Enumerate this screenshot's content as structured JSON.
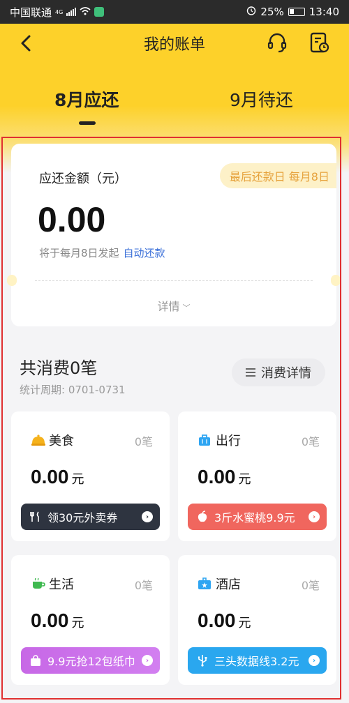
{
  "status_bar": {
    "carrier": "中国联通",
    "network": "4G",
    "battery": "25%",
    "time": "13:40"
  },
  "nav": {
    "title": "我的账单"
  },
  "tabs": [
    {
      "label": "8月应还",
      "active": true
    },
    {
      "label": "9月待还",
      "active": false
    }
  ],
  "summary": {
    "amount_label": "应还金额（元）",
    "due_label": "最后还款日 每月8日",
    "amount": "0.00",
    "auto_note": "将于每月8日发起",
    "auto_link": "自动还款",
    "details_label": "详情"
  },
  "consumption": {
    "title": "共消费0笔",
    "period": "统计周期: 0701-0731",
    "detail_button": "消费详情"
  },
  "categories": [
    {
      "name": "美食",
      "count": "0笔",
      "amount": "0.00",
      "unit": "元",
      "promo": "领30元外卖券",
      "icon": "food-icon",
      "promo_icon": "fork-knife-icon",
      "promo_color": "#2e3440"
    },
    {
      "name": "出行",
      "count": "0笔",
      "amount": "0.00",
      "unit": "元",
      "promo": "3斤水蜜桃9.9元",
      "icon": "luggage-icon",
      "promo_icon": "peach-icon",
      "promo_color": "#f0665e"
    },
    {
      "name": "生活",
      "count": "0笔",
      "amount": "0.00",
      "unit": "元",
      "promo": "9.9元抢12包纸巾",
      "icon": "cup-icon",
      "promo_icon": "bag-icon",
      "promo_color": "#c768e6"
    },
    {
      "name": "酒店",
      "count": "0笔",
      "amount": "0.00",
      "unit": "元",
      "promo": "三头数据线3.2元",
      "icon": "hotel-icon",
      "promo_icon": "usb-icon",
      "promo_color": "#2aa7ef"
    }
  ],
  "colors": {
    "brand_yellow": "#fdd12a",
    "link_blue": "#3a6fd8",
    "due_orange": "#e6a23c",
    "frame_red": "#e03030"
  }
}
